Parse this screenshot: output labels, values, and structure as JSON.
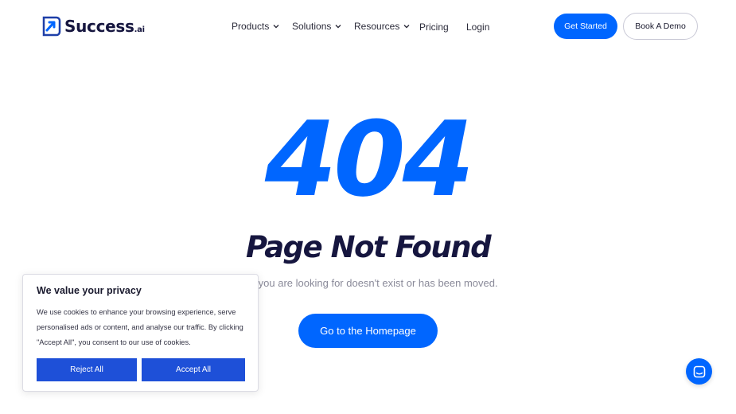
{
  "brand": {
    "name": "Success",
    "suffix": ".ai",
    "accent": "#0066ff"
  },
  "nav": {
    "products": "Products",
    "solutions": "Solutions",
    "resources": "Resources",
    "pricing": "Pricing",
    "login": "Login"
  },
  "header_buttons": {
    "get_started": "Get Started",
    "book_demo": "Book A Demo"
  },
  "error": {
    "code": "404",
    "title": "Page Not Found",
    "message": "age you are looking for doesn't exist or has been moved.",
    "home_button": "Go to the Homepage"
  },
  "cookie_banner": {
    "title": "We value your privacy",
    "text": "We use cookies to enhance your browsing experience, serve personalised ads or content, and analyse our traffic. By clicking \"Accept All\", you consent to our use of cookies.",
    "reject_label": "Reject All",
    "accept_label": "Accept All",
    "button_color": "#1e50d8"
  },
  "chat": {
    "icon": "chat-icon"
  }
}
